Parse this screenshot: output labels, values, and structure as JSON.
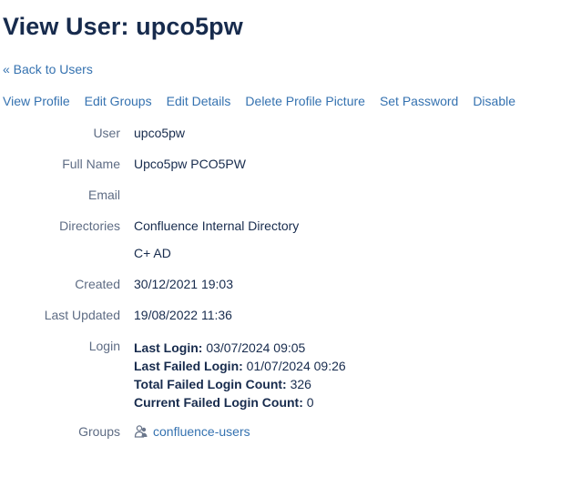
{
  "page": {
    "title": "View User: upco5pw",
    "back_link": "« Back to Users"
  },
  "actions": [
    {
      "label": "View Profile"
    },
    {
      "label": "Edit Groups"
    },
    {
      "label": "Edit Details"
    },
    {
      "label": "Delete Profile Picture"
    },
    {
      "label": "Set Password"
    },
    {
      "label": "Disable"
    }
  ],
  "fields": {
    "user": {
      "label": "User",
      "value": "upco5pw"
    },
    "full_name": {
      "label": "Full Name",
      "value": "Upco5pw PCO5PW"
    },
    "email": {
      "label": "Email",
      "value": ""
    },
    "directories": {
      "label": "Directories",
      "values": [
        "Confluence Internal Directory",
        "C+ AD"
      ]
    },
    "created": {
      "label": "Created",
      "value": "30/12/2021 19:03"
    },
    "last_updated": {
      "label": "Last Updated",
      "value": "19/08/2022 11:36"
    },
    "login": {
      "label": "Login",
      "last_login_label": "Last Login:",
      "last_login": "03/07/2024 09:05",
      "last_failed_label": "Last Failed Login:",
      "last_failed": "01/07/2024 09:26",
      "total_failed_label": "Total Failed Login Count:",
      "total_failed": "326",
      "current_failed_label": "Current Failed Login Count:",
      "current_failed": "0"
    },
    "groups": {
      "label": "Groups",
      "values": [
        "confluence-users"
      ],
      "icon": "group-icon"
    }
  },
  "colors": {
    "link": "#3572b0",
    "text": "#172b4d",
    "label": "#5e6c84"
  }
}
